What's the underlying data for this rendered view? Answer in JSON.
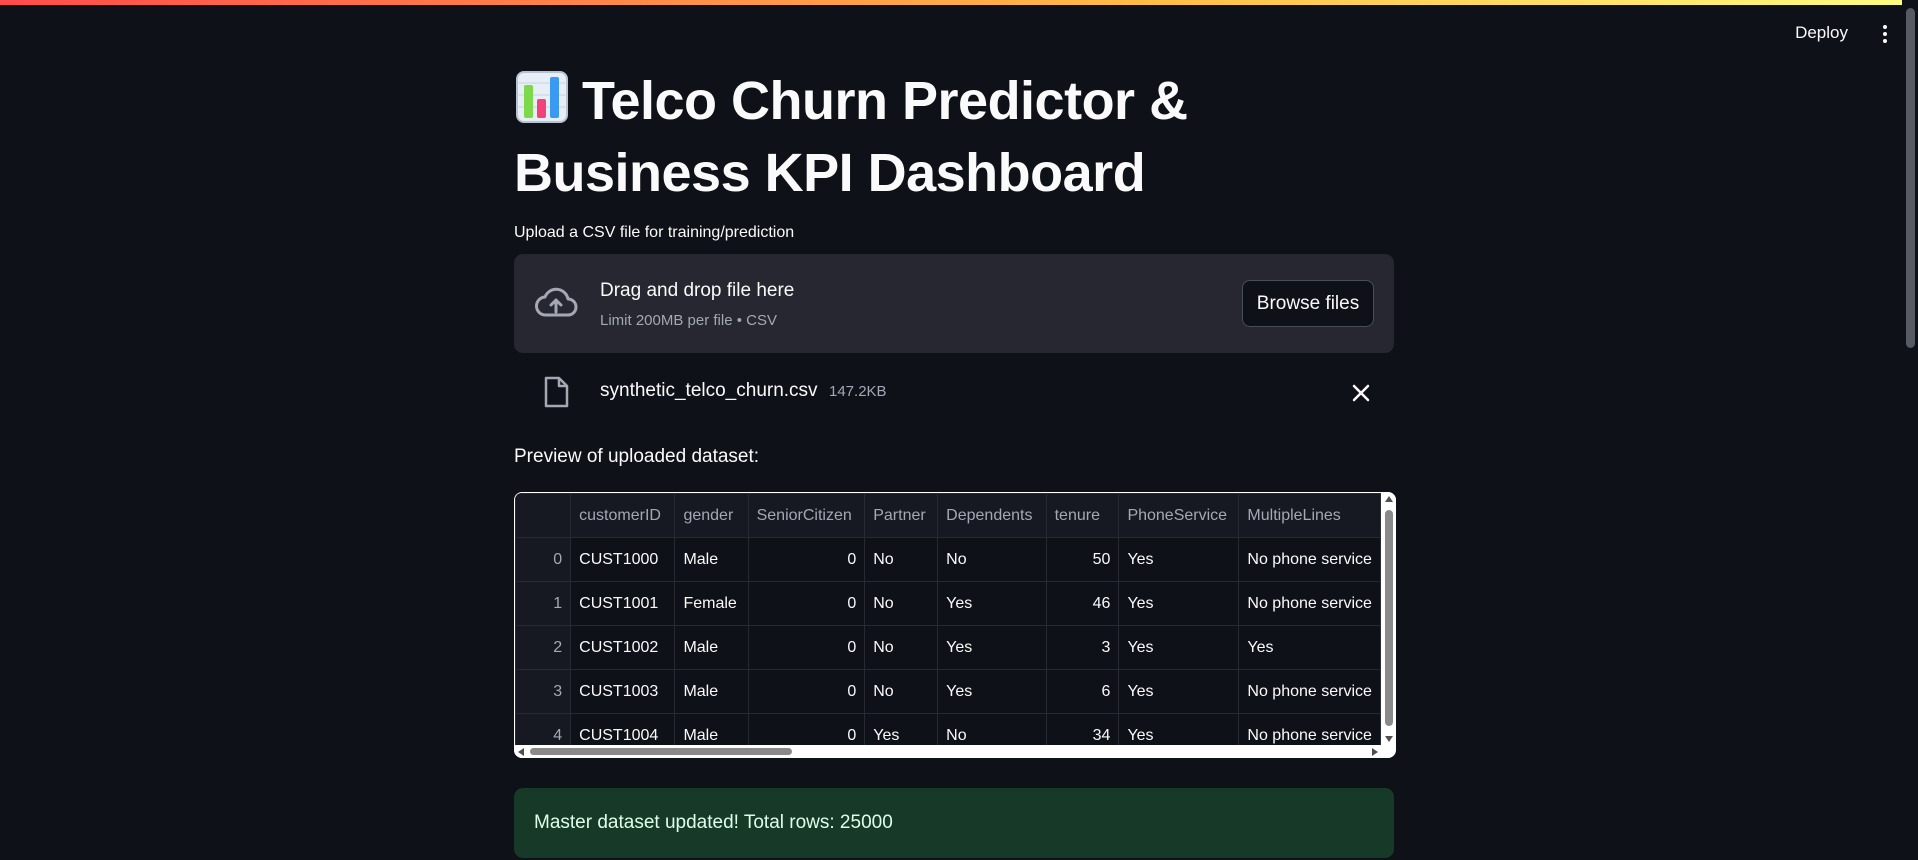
{
  "header": {
    "deploy_label": "Deploy"
  },
  "page": {
    "title": "Telco Churn Predictor & Business KPI Dashboard",
    "title_icon": "bar-chart-emoji"
  },
  "uploader": {
    "label": "Upload a CSV file for training/prediction",
    "drop_title": "Drag and drop file here",
    "drop_subtitle": "Limit 200MB per file • CSV",
    "browse_label": "Browse files",
    "file": {
      "name": "synthetic_telco_churn.csv",
      "size": "147.2KB"
    }
  },
  "preview": {
    "label": "Preview of uploaded dataset:",
    "columns": [
      "",
      "customerID",
      "gender",
      "SeniorCitizen",
      "Partner",
      "Dependents",
      "tenure",
      "PhoneService",
      "MultipleLines"
    ],
    "rows": [
      [
        "0",
        "CUST1000",
        "Male",
        "0",
        "No",
        "No",
        "50",
        "Yes",
        "No phone service"
      ],
      [
        "1",
        "CUST1001",
        "Female",
        "0",
        "No",
        "Yes",
        "46",
        "Yes",
        "No phone service"
      ],
      [
        "2",
        "CUST1002",
        "Male",
        "0",
        "No",
        "Yes",
        "3",
        "Yes",
        "Yes"
      ],
      [
        "3",
        "CUST1003",
        "Male",
        "0",
        "No",
        "Yes",
        "6",
        "Yes",
        "No phone service"
      ],
      [
        "4",
        "CUST1004",
        "Male",
        "0",
        "Yes",
        "No",
        "34",
        "Yes",
        "No phone service"
      ]
    ]
  },
  "status": {
    "message": "Master dataset updated! Total rows: 25000"
  }
}
